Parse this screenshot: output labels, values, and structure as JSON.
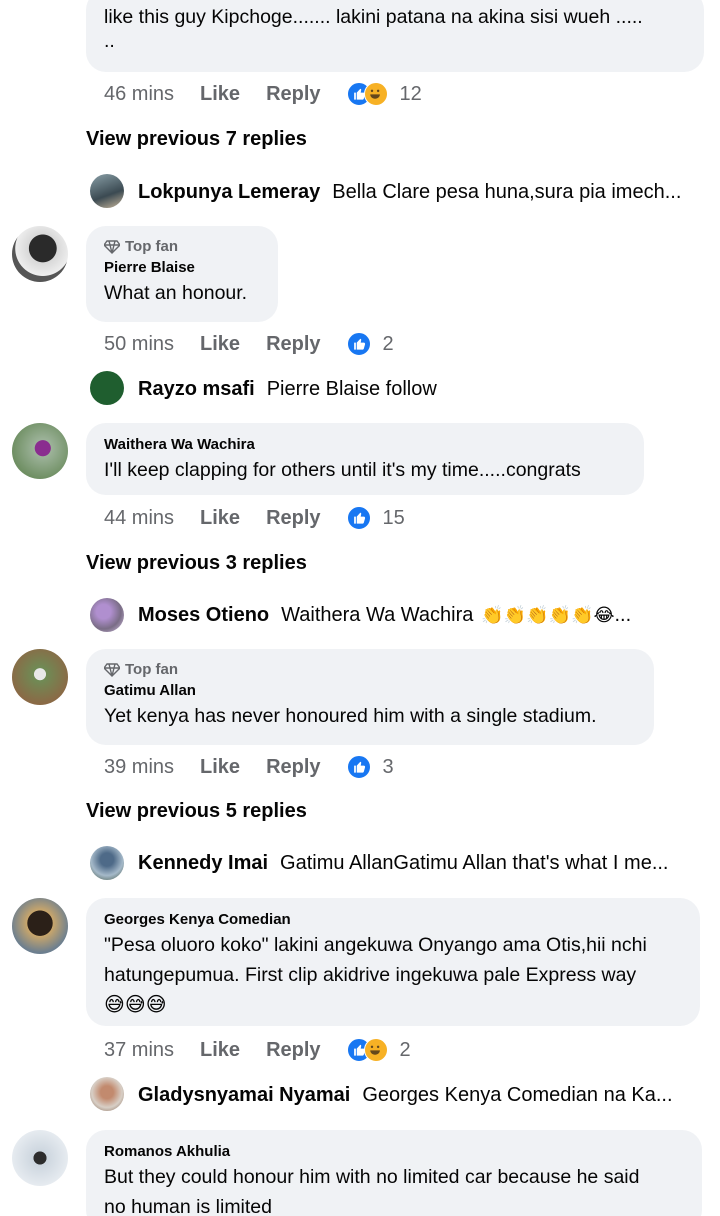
{
  "c0": {
    "text1": "like this guy Kipchoge....... lakini patana na akina sisi wueh .....",
    "text2": "..",
    "time": "46 mins",
    "like": "Like",
    "reply": "Reply",
    "count": "12"
  },
  "vp1": "View previous 7 replies",
  "r1": {
    "name": "Lokpunya Lemeray",
    "text": "Bella Clare pesa huna,sura pia imech..."
  },
  "c1": {
    "badge": "Top fan",
    "author": "Pierre Blaise",
    "text": "What an honour.",
    "time": "50 mins",
    "like": "Like",
    "reply": "Reply",
    "count": "2"
  },
  "r2": {
    "name": "Rayzo msafi",
    "text": "Pierre Blaise follow"
  },
  "c2": {
    "author": "Waithera Wa Wachira",
    "text": "I'll keep clapping for others until it's my time.....congrats",
    "time": "44 mins",
    "like": "Like",
    "reply": "Reply",
    "count": "15"
  },
  "vp2": "View previous 3 replies",
  "r3": {
    "name": "Moses Otieno",
    "text": "Waithera Wa Wachira",
    "emoji": "👏👏👏👏👏😂",
    "ell": "..."
  },
  "c3": {
    "badge": "Top fan",
    "author": "Gatimu Allan",
    "text": "Yet kenya has never honoured him with a single stadium.",
    "time": "39 mins",
    "like": "Like",
    "reply": "Reply",
    "count": "3"
  },
  "vp3": "View previous 5 replies",
  "r4": {
    "name": "Kennedy Imai",
    "text": "Gatimu AllanGatimu Allan that's what I me..."
  },
  "c4": {
    "author": "Georges Kenya Comedian",
    "line1": "\"Pesa oluoro koko\" lakini angekuwa Onyango ama Otis,hii nchi",
    "line2": "hatungepumua. First clip akidrive ingekuwa pale Express way",
    "emoji": "😅😅😅",
    "time": "37 mins",
    "like": "Like",
    "reply": "Reply",
    "count": "2"
  },
  "r5": {
    "name": "Gladysnyamai Nyamai",
    "text": "Georges Kenya Comedian na Ka..."
  },
  "c5": {
    "author": "Romanos Akhulia",
    "line1": "But they could honour him with no limited car because he said",
    "line2": "no human is limited"
  },
  "colors": {
    "bubble": "#f0f2f5",
    "meta": "#65676b",
    "like_blue": "#1877f2"
  }
}
